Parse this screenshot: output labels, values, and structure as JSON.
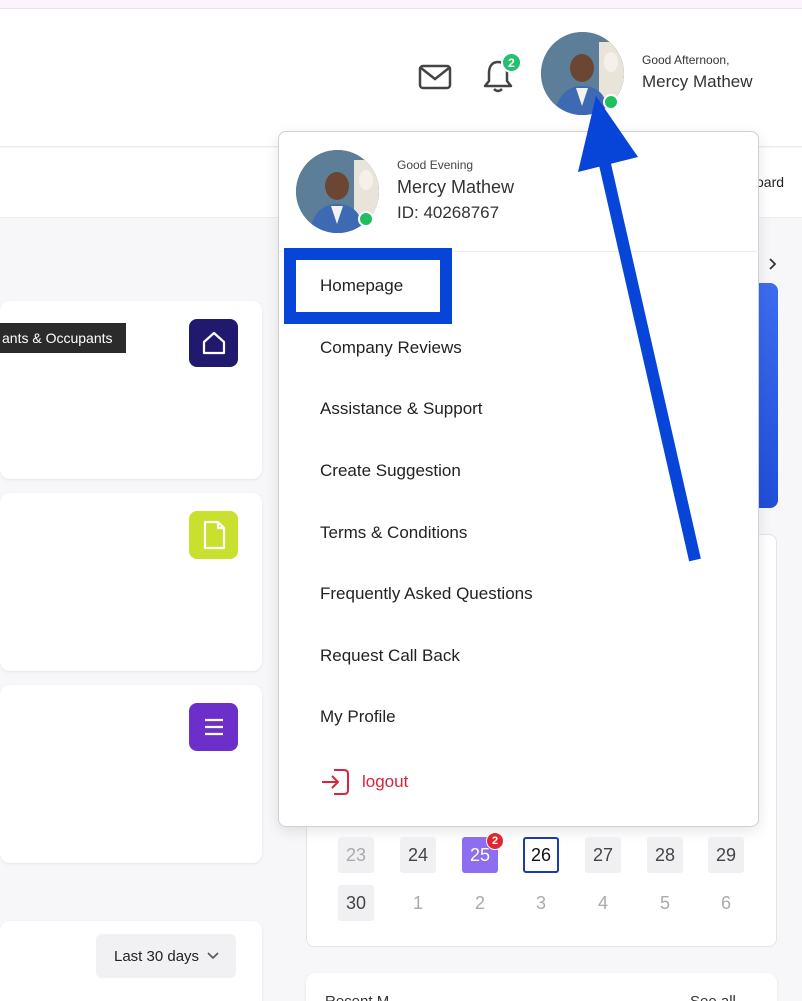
{
  "header": {
    "notification_count": "2",
    "greeting": "Good Afternoon,",
    "user_name": "Mercy Mathew"
  },
  "subbar": {
    "partial_text": "oard"
  },
  "tooltip": {
    "text": "ants & Occupants"
  },
  "dropdown": {
    "greeting": "Good Evening",
    "user_name": "Mercy Mathew",
    "user_id": "ID: 40268767",
    "items": [
      {
        "label": "Homepage"
      },
      {
        "label": "Company Reviews"
      },
      {
        "label": "Assistance & Support"
      },
      {
        "label": "Create Suggestion"
      },
      {
        "label": "Terms & Conditions"
      },
      {
        "label": "Frequently Asked Questions"
      },
      {
        "label": "Request Call Back"
      },
      {
        "label": "My Profile"
      }
    ],
    "logout_label": "logout"
  },
  "calendar": {
    "row1": [
      "23",
      "24",
      "25",
      "26",
      "27",
      "28",
      "29"
    ],
    "row2": [
      "30",
      "1",
      "2",
      "3",
      "4",
      "5",
      "6"
    ],
    "selected_badge": "2"
  },
  "filters": {
    "range_label": "Last 30 days"
  },
  "bottom_card": {
    "title_partial": "Recent M",
    "link_partial": "See all"
  },
  "colors": {
    "highlight": "#0645d8",
    "arrow": "#0645d8",
    "online": "#1fbf5f",
    "logout": "#d8243c",
    "tile_home": "#1f1a6e",
    "tile_doc": "#c9e02e",
    "tile_list": "#6d2fc9"
  }
}
